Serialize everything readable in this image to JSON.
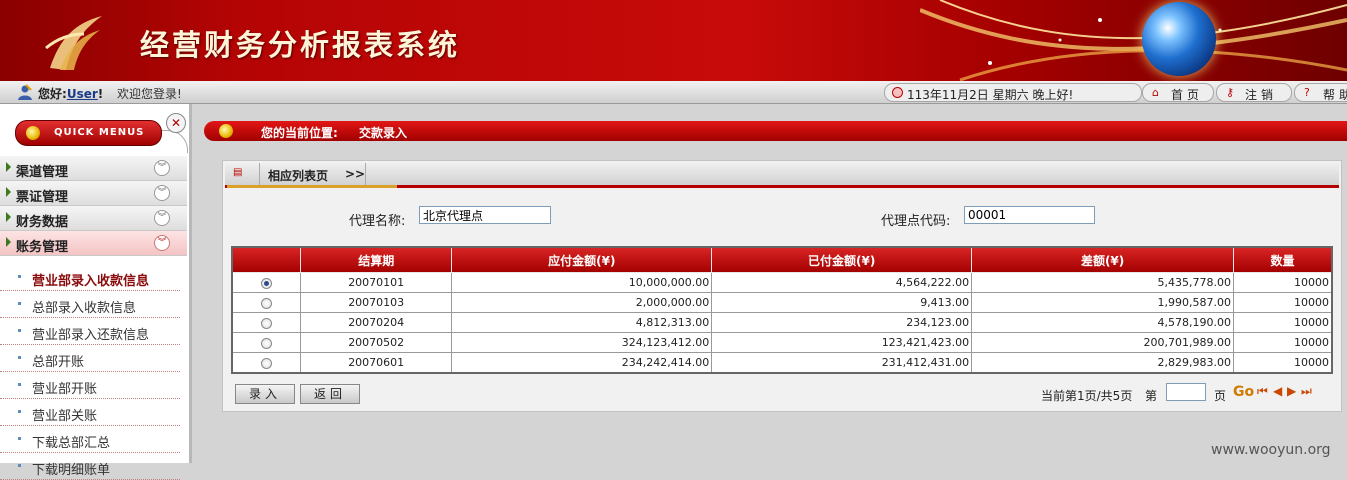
{
  "header": {
    "title": "经营财务分析报表系统"
  },
  "infobar": {
    "greeting": "您好",
    "user": "User",
    "welcome": "欢迎您登录!",
    "datetime": "113年11月2日 星期六 晚上好!",
    "nav": [
      {
        "label": "首页",
        "icon": "home-icon"
      },
      {
        "label": "注销",
        "icon": "key-icon"
      },
      {
        "label": "帮助",
        "icon": "help-icon"
      }
    ]
  },
  "sidebar": {
    "quick_menus": "QUICK MENUS",
    "categories": [
      {
        "label": "渠道管理"
      },
      {
        "label": "票证管理"
      },
      {
        "label": "财务数据"
      },
      {
        "label": "账务管理",
        "active": true
      }
    ],
    "items": [
      {
        "label": "营业部录入收款信息",
        "active": true
      },
      {
        "label": "总部录入收款信息"
      },
      {
        "label": "营业部录入还款信息"
      },
      {
        "label": "总部开账"
      },
      {
        "label": "营业部开账"
      },
      {
        "label": "营业部关账"
      },
      {
        "label": "下载总部汇总"
      },
      {
        "label": "下载明细账单"
      }
    ]
  },
  "breadcrumb": {
    "label": "您的当前位置:",
    "value": "交款录入"
  },
  "panel": {
    "tab_label": "相应列表页",
    "tab_arrow": ">>",
    "agent_name_label": "代理名称:",
    "agent_name_value": "北京代理点",
    "agent_code_label": "代理点代码:",
    "agent_code_value": "00001"
  },
  "table": {
    "headers": [
      "",
      "结算期",
      "应付金额(¥)",
      "已付金额(¥)",
      "差额(¥)",
      "数量"
    ],
    "rows": [
      {
        "selected": true,
        "period": "20070101",
        "payable": "10,000,000.00",
        "paid": "4,564,222.00",
        "diff": "5,435,778.00",
        "qty": "10000"
      },
      {
        "selected": false,
        "period": "20070103",
        "payable": "2,000,000.00",
        "paid": "9,413.00",
        "diff": "1,990,587.00",
        "qty": "10000"
      },
      {
        "selected": false,
        "period": "20070204",
        "payable": "4,812,313.00",
        "paid": "234,123.00",
        "diff": "4,578,190.00",
        "qty": "10000"
      },
      {
        "selected": false,
        "period": "20070502",
        "payable": "324,123,412.00",
        "paid": "123,421,423.00",
        "diff": "200,701,989.00",
        "qty": "10000"
      },
      {
        "selected": false,
        "period": "20070601",
        "payable": "234,242,414.00",
        "paid": "231,412,431.00",
        "diff": "2,829,983.00",
        "qty": "10000"
      }
    ]
  },
  "actions": {
    "submit": "录入",
    "back": "返回"
  },
  "pager": {
    "status": "当前第1页/共5页",
    "page_prefix": "第",
    "page_suffix": "页",
    "go": "Go"
  },
  "watermark": "www.wooyun.org"
}
